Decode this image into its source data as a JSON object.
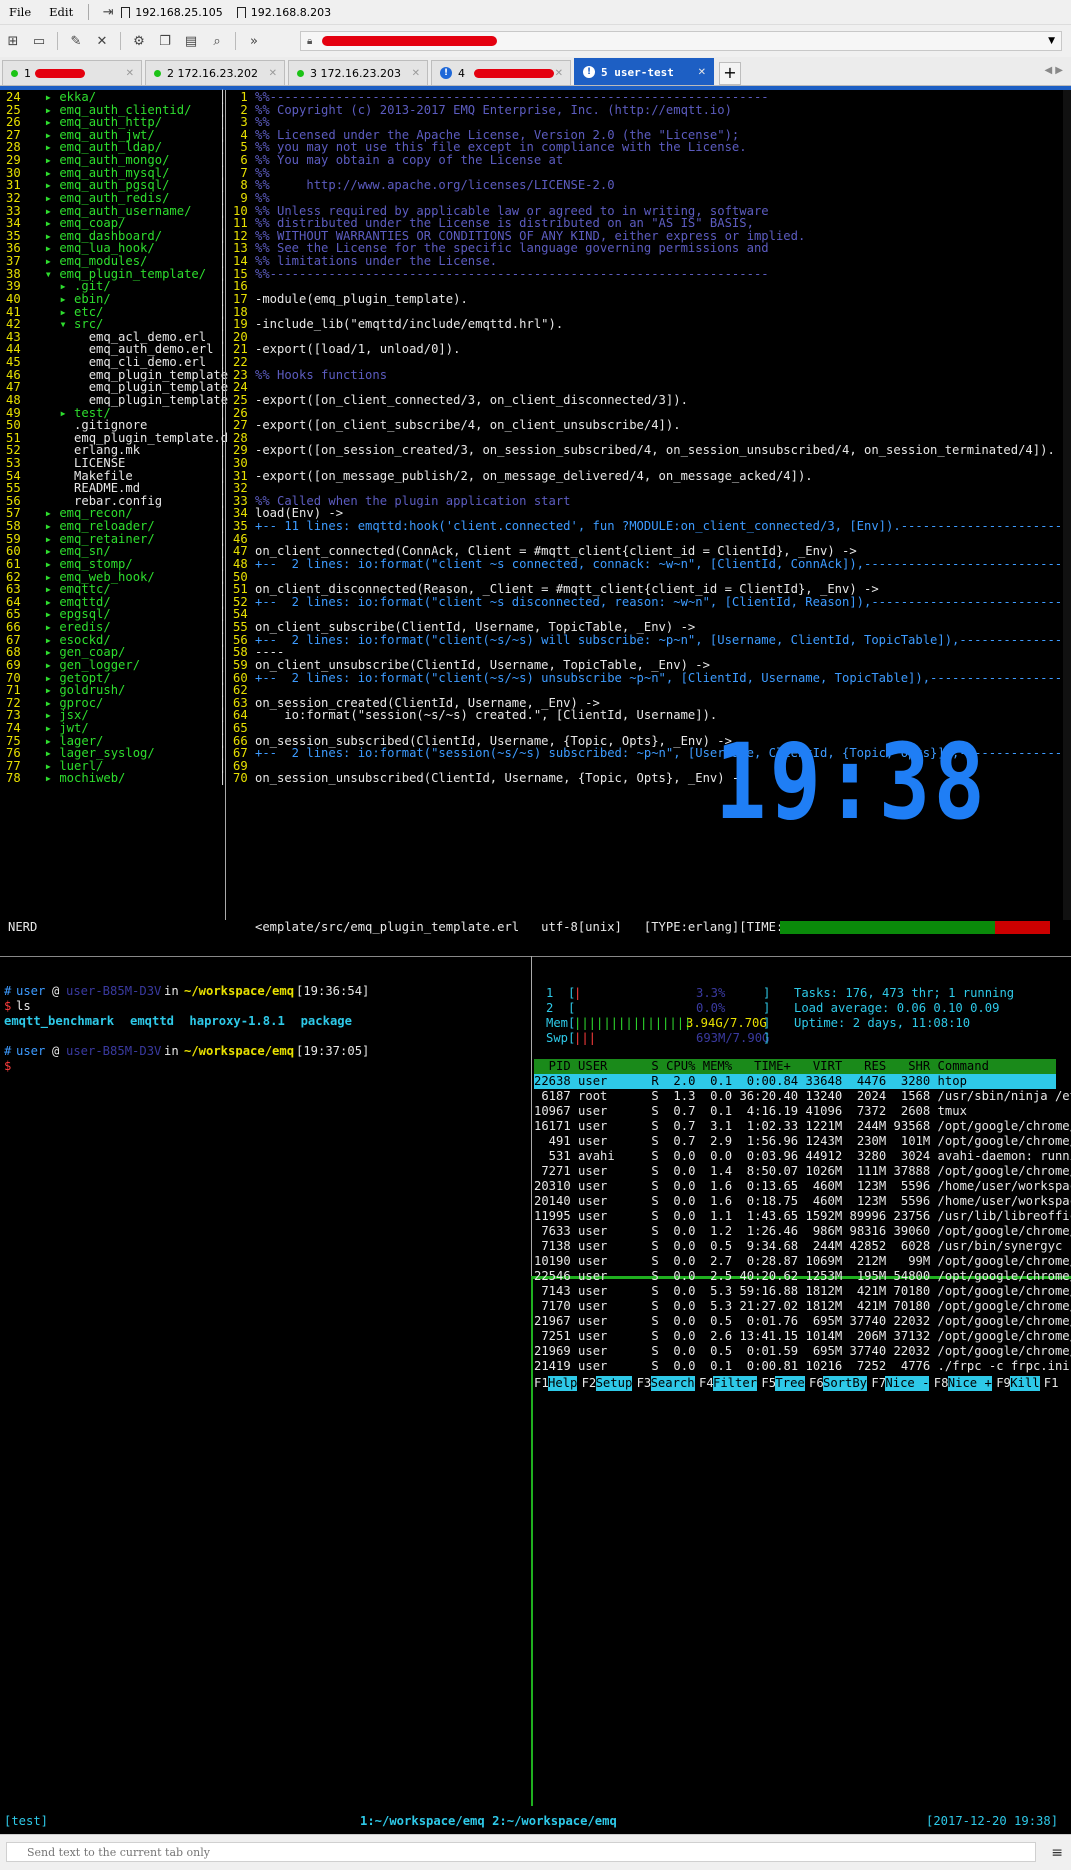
{
  "menu": {
    "file": "File",
    "edit": "Edit",
    "bookmark1": "192.168.25.105",
    "bookmark2": "192.168.8.203"
  },
  "tabs": [
    {
      "label": "1",
      "status": "green"
    },
    {
      "label": "2 172.16.23.202",
      "status": "green"
    },
    {
      "label": "3 172.16.23.203",
      "status": "green"
    },
    {
      "label": "4",
      "status": "warn"
    },
    {
      "label": "5 user-test",
      "status": "warn"
    }
  ],
  "vim": {
    "tree": [
      {
        "n": "24",
        "t": "  ▸ ekka/",
        "c": "grn"
      },
      {
        "n": "25",
        "t": "  ▸ emq_auth_clientid/",
        "c": "grn"
      },
      {
        "n": "26",
        "t": "  ▸ emq_auth_http/",
        "c": "grn"
      },
      {
        "n": "27",
        "t": "  ▸ emq_auth_jwt/",
        "c": "grn"
      },
      {
        "n": "28",
        "t": "  ▸ emq_auth_ldap/",
        "c": "grn"
      },
      {
        "n": "29",
        "t": "  ▸ emq_auth_mongo/",
        "c": "grn"
      },
      {
        "n": "30",
        "t": "  ▸ emq_auth_mysql/",
        "c": "grn"
      },
      {
        "n": "31",
        "t": "  ▸ emq_auth_pgsql/",
        "c": "grn"
      },
      {
        "n": "32",
        "t": "  ▸ emq_auth_redis/",
        "c": "grn"
      },
      {
        "n": "33",
        "t": "  ▸ emq_auth_username/",
        "c": "grn"
      },
      {
        "n": "34",
        "t": "  ▸ emq_coap/",
        "c": "grn"
      },
      {
        "n": "35",
        "t": "  ▸ emq_dashboard/",
        "c": "grn"
      },
      {
        "n": "36",
        "t": "  ▸ emq_lua_hook/",
        "c": "grn"
      },
      {
        "n": "37",
        "t": "  ▸ emq_modules/",
        "c": "grn"
      },
      {
        "n": "38",
        "t": "  ▾ emq_plugin_template/",
        "c": "grn"
      },
      {
        "n": "39",
        "t": "    ▸ .git/",
        "c": "grn"
      },
      {
        "n": "40",
        "t": "    ▸ ebin/",
        "c": "grn"
      },
      {
        "n": "41",
        "t": "    ▸ etc/",
        "c": "grn"
      },
      {
        "n": "42",
        "t": "    ▾ src/",
        "c": "grn"
      },
      {
        "n": "43",
        "t": "        emq_acl_demo.erl",
        "c": "wht"
      },
      {
        "n": "44",
        "t": "        emq_auth_demo.erl",
        "c": "wht"
      },
      {
        "n": "45",
        "t": "        emq_cli_demo.erl",
        "c": "wht"
      },
      {
        "n": "46",
        "t": "        emq_plugin_template",
        "c": "wht"
      },
      {
        "n": "47",
        "t": "        emq_plugin_template",
        "c": "wht"
      },
      {
        "n": "48",
        "t": "        emq_plugin_template",
        "c": "wht"
      },
      {
        "n": "49",
        "t": "    ▸ test/",
        "c": "grn"
      },
      {
        "n": "50",
        "t": "      .gitignore",
        "c": "wht"
      },
      {
        "n": "51",
        "t": "      emq_plugin_template.d",
        "c": "wht"
      },
      {
        "n": "52",
        "t": "      erlang.mk",
        "c": "wht"
      },
      {
        "n": "53",
        "t": "      LICENSE",
        "c": "wht"
      },
      {
        "n": "54",
        "t": "      Makefile",
        "c": "wht"
      },
      {
        "n": "55",
        "t": "      README.md",
        "c": "wht"
      },
      {
        "n": "56",
        "t": "      rebar.config",
        "c": "wht"
      },
      {
        "n": "57",
        "t": "  ▸ emq_recon/",
        "c": "grn"
      },
      {
        "n": "58",
        "t": "  ▸ emq_reloader/",
        "c": "grn"
      },
      {
        "n": "59",
        "t": "  ▸ emq_retainer/",
        "c": "grn"
      },
      {
        "n": "60",
        "t": "  ▸ emq_sn/",
        "c": "grn"
      },
      {
        "n": "61",
        "t": "  ▸ emq_stomp/",
        "c": "grn"
      },
      {
        "n": "62",
        "t": "  ▸ emq_web_hook/",
        "c": "grn"
      },
      {
        "n": "63",
        "t": "  ▸ emqttc/",
        "c": "grn"
      },
      {
        "n": "64",
        "t": "  ▸ emqttd/",
        "c": "grn"
      },
      {
        "n": "65",
        "t": "  ▸ epgsql/",
        "c": "grn"
      },
      {
        "n": "66",
        "t": "  ▸ eredis/",
        "c": "grn"
      },
      {
        "n": "67",
        "t": "  ▸ esockd/",
        "c": "grn"
      },
      {
        "n": "68",
        "t": "  ▸ gen_coap/",
        "c": "grn"
      },
      {
        "n": "69",
        "t": "  ▸ gen_logger/",
        "c": "grn"
      },
      {
        "n": "70",
        "t": "  ▸ getopt/",
        "c": "grn"
      },
      {
        "n": "71",
        "t": "  ▸ goldrush/",
        "c": "grn"
      },
      {
        "n": "72",
        "t": "  ▸ gproc/",
        "c": "grn"
      },
      {
        "n": "73",
        "t": "  ▸ jsx/",
        "c": "grn"
      },
      {
        "n": "74",
        "t": "  ▸ jwt/",
        "c": "grn"
      },
      {
        "n": "75",
        "t": "  ▸ lager/",
        "c": "grn"
      },
      {
        "n": "76",
        "t": "  ▸ lager_syslog/",
        "c": "grn"
      },
      {
        "n": "77",
        "t": "  ▸ luerl/",
        "c": "grn"
      },
      {
        "n": "78",
        "t": "  ▸ mochiweb/",
        "c": "grn"
      }
    ],
    "code": [
      {
        "n": "1",
        "t": "%%--------------------------------------------------------------------",
        "c": "com"
      },
      {
        "n": "2",
        "t": "%% Copyright (c) 2013-2017 EMQ Enterprise, Inc. (http://emqtt.io)",
        "c": "com"
      },
      {
        "n": "3",
        "t": "%%",
        "c": "com"
      },
      {
        "n": "4",
        "t": "%% Licensed under the Apache License, Version 2.0 (the \"License\");",
        "c": "com"
      },
      {
        "n": "5",
        "t": "%% you may not use this file except in compliance with the License.",
        "c": "com"
      },
      {
        "n": "6",
        "t": "%% You may obtain a copy of the License at",
        "c": "com"
      },
      {
        "n": "7",
        "t": "%%",
        "c": "com"
      },
      {
        "n": "8",
        "t": "%%     http://www.apache.org/licenses/LICENSE-2.0",
        "c": "com"
      },
      {
        "n": "9",
        "t": "%%",
        "c": "com"
      },
      {
        "n": "10",
        "t": "%% Unless required by applicable law or agreed to in writing, software",
        "c": "com"
      },
      {
        "n": "11",
        "t": "%% distributed under the License is distributed on an \"AS IS\" BASIS,",
        "c": "com"
      },
      {
        "n": "12",
        "t": "%% WITHOUT WARRANTIES OR CONDITIONS OF ANY KIND, either express or implied.",
        "c": "com"
      },
      {
        "n": "13",
        "t": "%% See the License for the specific language governing permissions and",
        "c": "com"
      },
      {
        "n": "14",
        "t": "%% limitations under the License.",
        "c": "com"
      },
      {
        "n": "15",
        "t": "%%--------------------------------------------------------------------",
        "c": "com"
      },
      {
        "n": "16",
        "t": "",
        "c": "wht"
      },
      {
        "n": "17",
        "t": "-module(emq_plugin_template).",
        "c": "wht"
      },
      {
        "n": "18",
        "t": "",
        "c": "wht"
      },
      {
        "n": "19",
        "t": "-include_lib(\"emqttd/include/emqttd.hrl\").",
        "c": "wht"
      },
      {
        "n": "20",
        "t": "",
        "c": "wht"
      },
      {
        "n": "21",
        "t": "-export([load/1, unload/0]).",
        "c": "wht"
      },
      {
        "n": "22",
        "t": "",
        "c": "wht"
      },
      {
        "n": "23",
        "t": "%% Hooks functions",
        "c": "com"
      },
      {
        "n": "24",
        "t": "",
        "c": "wht"
      },
      {
        "n": "25",
        "t": "-export([on_client_connected/3, on_client_disconnected/3]).",
        "c": "wht"
      },
      {
        "n": "26",
        "t": "",
        "c": "wht"
      },
      {
        "n": "27",
        "t": "-export([on_client_subscribe/4, on_client_unsubscribe/4]).",
        "c": "wht"
      },
      {
        "n": "28",
        "t": "",
        "c": "wht"
      },
      {
        "n": "29",
        "t": "-export([on_session_created/3, on_session_subscribed/4, on_session_unsubscribed/4, on_session_terminated/4]).",
        "c": "wht"
      },
      {
        "n": "30",
        "t": "",
        "c": "wht"
      },
      {
        "n": "31",
        "t": "-export([on_message_publish/2, on_message_delivered/4, on_message_acked/4]).",
        "c": "wht"
      },
      {
        "n": "32",
        "t": "",
        "c": "wht"
      },
      {
        "n": "33",
        "t": "%% Called when the plugin application start",
        "c": "com"
      },
      {
        "n": "34",
        "t": "load(Env) ->",
        "c": "wht"
      },
      {
        "n": "35",
        "t": "+-- 11 lines: emqttd:hook('client.connected', fun ?MODULE:on_client_connected/3, [Env]).------------------------",
        "c": "blu"
      },
      {
        "n": "46",
        "t": "",
        "c": "wht"
      },
      {
        "n": "47",
        "t": "on_client_connected(ConnAck, Client = #mqtt_client{client_id = ClientId}, _Env) ->",
        "c": "wht"
      },
      {
        "n": "48",
        "t": "+--  2 lines: io:format(\"client ~s connected, connack: ~w~n\", [ClientId, ConnAck]),------------------------------",
        "c": "blu"
      },
      {
        "n": "50",
        "t": "",
        "c": "wht"
      },
      {
        "n": "51",
        "t": "on_client_disconnected(Reason, _Client = #mqtt_client{client_id = ClientId}, _Env) ->",
        "c": "wht"
      },
      {
        "n": "52",
        "t": "+--  2 lines: io:format(\"client ~s disconnected, reason: ~w~n\", [ClientId, Reason]),--------------------------",
        "c": "blu"
      },
      {
        "n": "54",
        "t": "",
        "c": "wht"
      },
      {
        "n": "55",
        "t": "on_client_subscribe(ClientId, Username, TopicTable, _Env) ->",
        "c": "wht"
      },
      {
        "n": "56",
        "t": "+--  2 lines: io:format(\"client(~s/~s) will subscribe: ~p~n\", [Username, ClientId, TopicTable]),---------------",
        "c": "blu"
      },
      {
        "n": "58",
        "t": "----",
        "c": "wht"
      },
      {
        "n": "59",
        "t": "on_client_unsubscribe(ClientId, Username, TopicTable, _Env) ->",
        "c": "wht"
      },
      {
        "n": "60",
        "t": "+--  2 lines: io:format(\"client(~s/~s) unsubscribe ~p~n\", [ClientId, Username, TopicTable]),------------------",
        "c": "blu"
      },
      {
        "n": "62",
        "t": "",
        "c": "wht"
      },
      {
        "n": "63",
        "t": "on_session_created(ClientId, Username, _Env) ->",
        "c": "wht"
      },
      {
        "n": "64",
        "t": "    io:format(\"session(~s/~s) created.\", [ClientId, Username]).",
        "c": "wht"
      },
      {
        "n": "65",
        "t": "",
        "c": "wht"
      },
      {
        "n": "66",
        "t": "on_session_subscribed(ClientId, Username, {Topic, Opts}, _Env) ->",
        "c": "wht"
      },
      {
        "n": "67",
        "t": "+--  2 lines: io:format(\"session(~s/~s) subscribed: ~p~n\", [Username, ClientId, {Topic, Opts}]),--------------",
        "c": "blu"
      },
      {
        "n": "69",
        "t": "",
        "c": "wht"
      },
      {
        "n": "70",
        "t": "on_session_unsubscribed(ClientId, Username, {Topic, Opts}, _Env) ->",
        "c": "wht"
      }
    ],
    "status_left": "NERD",
    "status_file": "<emplate/src/emq_plugin_template.erl   utf-8[unix]   [TYPE:erlang][TIME:19:36]"
  },
  "shell": [
    {
      "user": "user",
      "host": "user-B85M-D3V",
      "path": "~/workspace/emq",
      "time": "[19:36:54]"
    },
    {
      "cmd": "ls"
    },
    {
      "ls": [
        "emqtt_benchmark",
        "emqttd",
        "haproxy-1.8.1",
        "package"
      ]
    },
    {
      "user": "user",
      "host": "user-B85M-D3V",
      "path": "~/workspace/emq",
      "time": "[19:37:05]"
    }
  ],
  "htop": {
    "cpu1": "3.3%",
    "cpu2": "0.0%",
    "mem": "3.94G/7.70G",
    "swp": "693M/7.90G",
    "tasks": "Tasks: 176, 473 thr; 1 running",
    "load": "Load average: 0.06 0.10 0.09",
    "uptime": "Uptime: 2 days, 11:08:10",
    "header": "  PID USER      S CPU% MEM%   TIME+   VIRT   RES   SHR Command",
    "rows": [
      "22638 user      R  2.0  0.1  0:00.84 33648  4476  3280 htop",
      " 6187 root      S  1.3  0.0 36:20.40 13240  2024  1568 /usr/sbin/ninja /et",
      "10967 user      S  0.7  0.1  4:16.19 41096  7372  2608 tmux",
      "16171 user      S  0.7  3.1  1:02.33 1221M  244M 93568 /opt/google/chrome/",
      "  491 user      S  0.7  2.9  1:56.96 1243M  230M  101M /opt/google/chrome/",
      "  531 avahi     S  0.0  0.0  0:03.96 44912  3280  3024 avahi-daemon: runni",
      " 7271 user      S  0.0  1.4  8:50.07 1026M  111M 37888 /opt/google/chrome/",
      "20310 user      S  0.0  1.6  0:13.65  460M  123M  5596 /home/user/workspac",
      "20140 user      S  0.0  1.6  0:18.75  460M  123M  5596 /home/user/workspac",
      "11995 user      S  0.0  1.1  1:43.65 1592M 89996 23756 /usr/lib/libreoffic",
      " 7633 user      S  0.0  1.2  1:26.46  986M 98316 39060 /opt/google/chrome/",
      " 7138 user      S  0.0  0.5  9:34.68  244M 42852  6028 /usr/bin/synergyc -",
      "10190 user      S  0.0  2.7  0:28.87 1069M  212M   99M /opt/google/chrome/",
      "22546 user      S  0.0  2.5 40:20.62 1253M  195M 54800 /opt/google/chrome/",
      " 7143 user      S  0.0  5.3 59:16.88 1812M  421M 70180 /opt/google/chrome/",
      " 7170 user      S  0.0  5.3 21:27.02 1812M  421M 70180 /opt/google/chrome/",
      "21967 user      S  0.0  0.5  0:01.76  695M 37740 22032 /opt/google/chrome/",
      " 7251 user      S  0.0  2.6 13:41.15 1014M  206M 37132 /opt/google/chrome/",
      "21969 user      S  0.0  0.5  0:01.59  695M 37740 22032 /opt/google/chrome/",
      "21419 user      S  0.0  0.1  0:00.81 10216  7252  4776 ./frpc -c frpc.ini"
    ],
    "fkeys": [
      [
        "F1",
        "Help"
      ],
      [
        "F2",
        "Setup"
      ],
      [
        "F3",
        "Search"
      ],
      [
        "F4",
        "Filter"
      ],
      [
        "F5",
        "Tree"
      ],
      [
        "F6",
        "SortBy"
      ],
      [
        "F7",
        "Nice -"
      ],
      [
        "F8",
        "Nice +"
      ],
      [
        "F9",
        "Kill"
      ],
      [
        "F1",
        ""
      ]
    ]
  },
  "clock": "19:38",
  "tmux": {
    "session": "[test]",
    "windows": "1:~/workspace/emq 2:~/workspace/emq",
    "datetime": "[2017-12-20 19:38]"
  },
  "sendbar": {
    "placeholder": "Send text to the current tab only"
  }
}
